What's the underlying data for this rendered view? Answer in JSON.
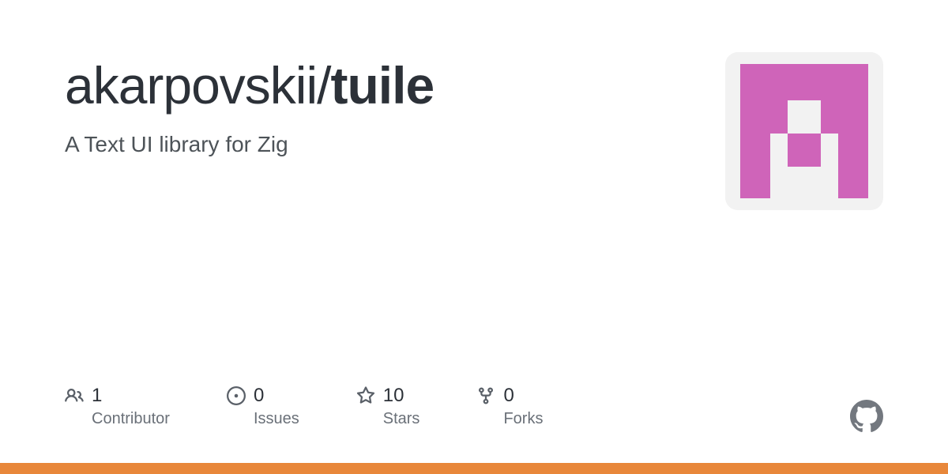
{
  "repo": {
    "owner": "akarpovskii",
    "slash": "/",
    "name": "tuile",
    "description": "A Text UI library for Zig"
  },
  "stats": {
    "contributors": {
      "value": "1",
      "label": "Contributor"
    },
    "issues": {
      "value": "0",
      "label": "Issues"
    },
    "stars": {
      "value": "10",
      "label": "Stars"
    },
    "forks": {
      "value": "0",
      "label": "Forks"
    }
  },
  "colors": {
    "accent_bar": "#e8873a",
    "avatar_pink": "#cf64b9",
    "avatar_bg": "#f2f2f2"
  }
}
